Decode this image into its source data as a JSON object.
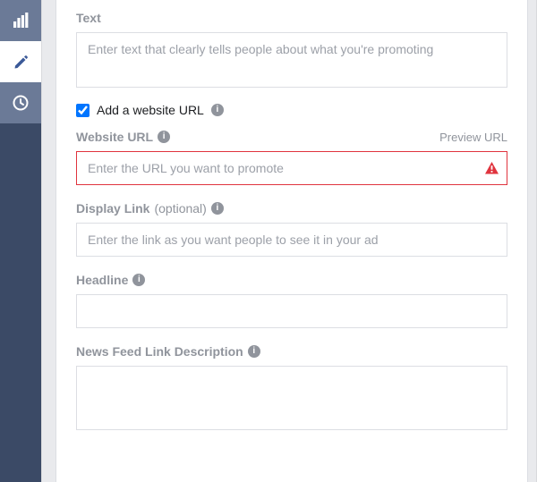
{
  "sidebar": {
    "items": [
      {
        "name": "performance",
        "icon": "bar-chart"
      },
      {
        "name": "edit",
        "icon": "pencil"
      },
      {
        "name": "history",
        "icon": "clock"
      }
    ]
  },
  "fields": {
    "text": {
      "label": "Text",
      "placeholder": "Enter text that clearly tells people about what you're promoting"
    },
    "add_url_checkbox": {
      "label": "Add a website URL",
      "checked": true
    },
    "website_url": {
      "label": "Website URL",
      "preview_label": "Preview URL",
      "placeholder": "Enter the URL you want to promote",
      "value": "",
      "error": true
    },
    "display_link": {
      "label": "Display Link",
      "optional": "(optional)",
      "placeholder": "Enter the link as you want people to see it in your ad",
      "value": ""
    },
    "headline": {
      "label": "Headline",
      "value": ""
    },
    "news_feed_desc": {
      "label": "News Feed Link Description",
      "value": ""
    }
  },
  "colors": {
    "sidebar_bg": "#4b5a78",
    "sidebar_dark": "#3b4a66",
    "accent": "#3b5998",
    "error": "#e0343e",
    "muted_text": "#90949c",
    "border": "#dcdee3"
  }
}
